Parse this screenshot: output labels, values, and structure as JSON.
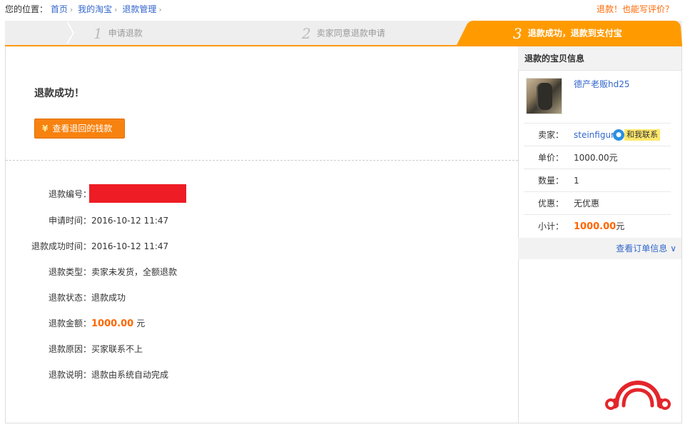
{
  "breadcrumb": {
    "prefix": "您的位置：",
    "items": [
      "首页",
      "我的淘宝",
      "退款管理"
    ]
  },
  "top_link": "退款！也能写评价？",
  "steps": [
    {
      "num": "1",
      "label": "申请退款"
    },
    {
      "num": "2",
      "label": "卖家同意退款申请"
    },
    {
      "num": "3",
      "label": "退款成功，退款到支付宝"
    }
  ],
  "main": {
    "title": "退款成功！",
    "view_button": "查看退回的钱款",
    "yen_icon": "¥",
    "rows": {
      "refund_no": {
        "label": "退款编号："
      },
      "apply_time": {
        "label": "申请时间：",
        "value": "2016-10-12 11:47"
      },
      "success_time": {
        "label": "退款成功时间：",
        "value": "2016-10-12 11:47"
      },
      "type": {
        "label": "退款类型：",
        "value": "卖家未发货，全额退款"
      },
      "status": {
        "label": "退款状态：",
        "value": "退款成功"
      },
      "amount": {
        "label": "退款金额：",
        "value": "1000.00",
        "unit": "元"
      },
      "reason": {
        "label": "退款原因：",
        "value": "买家联系不上"
      },
      "note": {
        "label": "退款说明：",
        "value": "退款由系统自动完成"
      }
    }
  },
  "side": {
    "title": "退款的宝贝信息",
    "item_name": "德产老贩hd25",
    "seller_label": "卖家：",
    "seller": "steinfigur",
    "contact": "和我联系",
    "price_label": "单价：",
    "price": "1000.00元",
    "qty_label": "数量：",
    "qty": "1",
    "discount_label": "优惠：",
    "discount": "无优惠",
    "subtotal_label": "小计：",
    "subtotal": "1000.00",
    "subtotal_unit": "元",
    "order_link": "查看订单信息",
    "chevron": "∨"
  },
  "colors": {
    "accent": "#f90",
    "button": "#f7820f",
    "link": "#3366cc",
    "amount": "#ff6600",
    "redaction": "#ee1c25",
    "logo": "#e3262b"
  }
}
